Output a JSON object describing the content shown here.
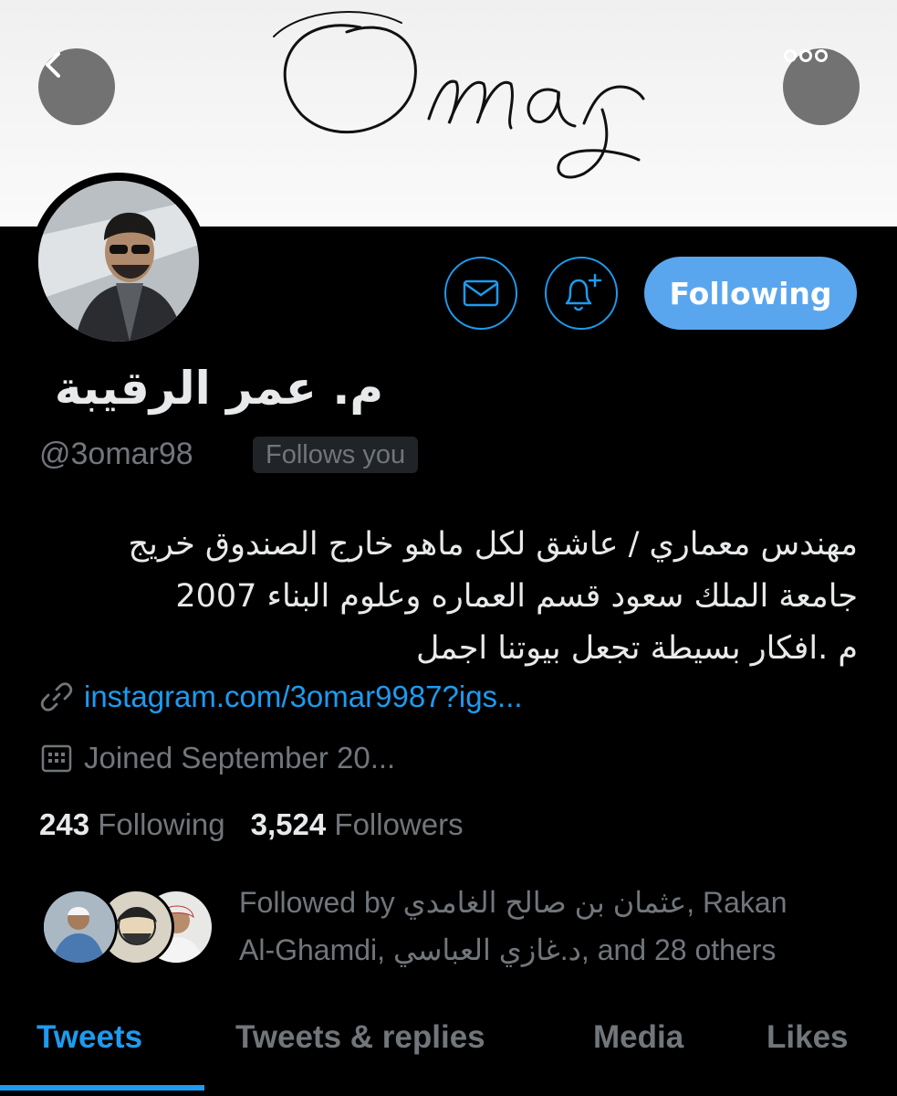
{
  "header": {
    "banner_signature": "Omar",
    "back_icon": "chevron-left-icon",
    "more_icon": "more-horizontal-icon"
  },
  "actions": {
    "message_icon": "mail-icon",
    "notify_icon": "bell-plus-icon",
    "follow_label": "Following"
  },
  "profile": {
    "display_name": "م. عمر الرقيبة",
    "handle": "@3omar98",
    "follows_you": "Follows you",
    "bio_lines": [
      "مهندس معماري / عاشق لكل ماهو خارج الصندوق خريج",
      "جامعة الملك سعود قسم العماره وعلوم البناء 2007",
      "م .افكار بسيطة تجعل بيوتنا اجمل"
    ],
    "link_icon": "link-icon",
    "link": "instagram.com/3omar9987?igs...",
    "calendar_icon": "calendar-icon",
    "joined": "Joined September 20..."
  },
  "stats": {
    "following_count": "243",
    "following_label": "Following",
    "followers_count": "3,524",
    "followers_label": "Followers"
  },
  "followed_by": {
    "line1": "Followed by عثمان بن صالح الغامدي, Rakan",
    "line2": "Al-Ghamdi, د.غازي العباسي, and 28 others"
  },
  "tabs": [
    "Tweets",
    "Tweets & replies",
    "Media",
    "Likes"
  ],
  "colors": {
    "accent": "#1d9bf0",
    "follow_button": "#5aa6ee",
    "background": "#000000",
    "muted": "#71767b"
  }
}
